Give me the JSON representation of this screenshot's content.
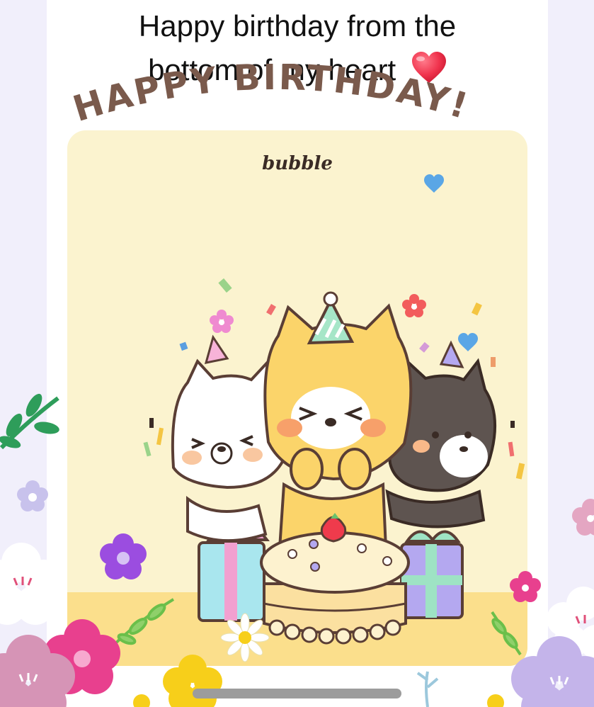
{
  "message": {
    "line1": "Happy birthday from the",
    "line2": "bottom of my heart",
    "heart_emoji": "red-heart-icon"
  },
  "card": {
    "brand": "bubble",
    "headline": "HAPPY BIRTHDAY!",
    "illustration": "shiba-dogs-birthday-cake-illustration",
    "colors": {
      "card_bg": "#fbf3cf",
      "floor": "#fbdf8c",
      "headline_text": "#7a5a4c"
    }
  },
  "system": {
    "home_indicator": "home-indicator"
  }
}
